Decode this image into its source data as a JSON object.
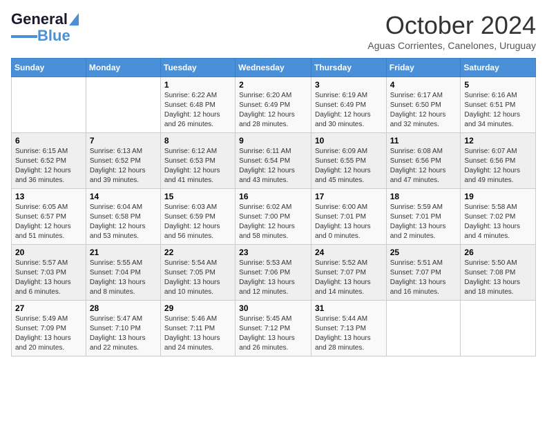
{
  "logo": {
    "line1": "General",
    "line2": "Blue"
  },
  "header": {
    "month": "October 2024",
    "location": "Aguas Corrientes, Canelones, Uruguay"
  },
  "days_of_week": [
    "Sunday",
    "Monday",
    "Tuesday",
    "Wednesday",
    "Thursday",
    "Friday",
    "Saturday"
  ],
  "weeks": [
    [
      {
        "day": "",
        "content": ""
      },
      {
        "day": "",
        "content": ""
      },
      {
        "day": "1",
        "content": "Sunrise: 6:22 AM\nSunset: 6:48 PM\nDaylight: 12 hours and 26 minutes."
      },
      {
        "day": "2",
        "content": "Sunrise: 6:20 AM\nSunset: 6:49 PM\nDaylight: 12 hours and 28 minutes."
      },
      {
        "day": "3",
        "content": "Sunrise: 6:19 AM\nSunset: 6:49 PM\nDaylight: 12 hours and 30 minutes."
      },
      {
        "day": "4",
        "content": "Sunrise: 6:17 AM\nSunset: 6:50 PM\nDaylight: 12 hours and 32 minutes."
      },
      {
        "day": "5",
        "content": "Sunrise: 6:16 AM\nSunset: 6:51 PM\nDaylight: 12 hours and 34 minutes."
      }
    ],
    [
      {
        "day": "6",
        "content": "Sunrise: 6:15 AM\nSunset: 6:52 PM\nDaylight: 12 hours and 36 minutes."
      },
      {
        "day": "7",
        "content": "Sunrise: 6:13 AM\nSunset: 6:52 PM\nDaylight: 12 hours and 39 minutes."
      },
      {
        "day": "8",
        "content": "Sunrise: 6:12 AM\nSunset: 6:53 PM\nDaylight: 12 hours and 41 minutes."
      },
      {
        "day": "9",
        "content": "Sunrise: 6:11 AM\nSunset: 6:54 PM\nDaylight: 12 hours and 43 minutes."
      },
      {
        "day": "10",
        "content": "Sunrise: 6:09 AM\nSunset: 6:55 PM\nDaylight: 12 hours and 45 minutes."
      },
      {
        "day": "11",
        "content": "Sunrise: 6:08 AM\nSunset: 6:56 PM\nDaylight: 12 hours and 47 minutes."
      },
      {
        "day": "12",
        "content": "Sunrise: 6:07 AM\nSunset: 6:56 PM\nDaylight: 12 hours and 49 minutes."
      }
    ],
    [
      {
        "day": "13",
        "content": "Sunrise: 6:05 AM\nSunset: 6:57 PM\nDaylight: 12 hours and 51 minutes."
      },
      {
        "day": "14",
        "content": "Sunrise: 6:04 AM\nSunset: 6:58 PM\nDaylight: 12 hours and 53 minutes."
      },
      {
        "day": "15",
        "content": "Sunrise: 6:03 AM\nSunset: 6:59 PM\nDaylight: 12 hours and 56 minutes."
      },
      {
        "day": "16",
        "content": "Sunrise: 6:02 AM\nSunset: 7:00 PM\nDaylight: 12 hours and 58 minutes."
      },
      {
        "day": "17",
        "content": "Sunrise: 6:00 AM\nSunset: 7:01 PM\nDaylight: 13 hours and 0 minutes."
      },
      {
        "day": "18",
        "content": "Sunrise: 5:59 AM\nSunset: 7:01 PM\nDaylight: 13 hours and 2 minutes."
      },
      {
        "day": "19",
        "content": "Sunrise: 5:58 AM\nSunset: 7:02 PM\nDaylight: 13 hours and 4 minutes."
      }
    ],
    [
      {
        "day": "20",
        "content": "Sunrise: 5:57 AM\nSunset: 7:03 PM\nDaylight: 13 hours and 6 minutes."
      },
      {
        "day": "21",
        "content": "Sunrise: 5:55 AM\nSunset: 7:04 PM\nDaylight: 13 hours and 8 minutes."
      },
      {
        "day": "22",
        "content": "Sunrise: 5:54 AM\nSunset: 7:05 PM\nDaylight: 13 hours and 10 minutes."
      },
      {
        "day": "23",
        "content": "Sunrise: 5:53 AM\nSunset: 7:06 PM\nDaylight: 13 hours and 12 minutes."
      },
      {
        "day": "24",
        "content": "Sunrise: 5:52 AM\nSunset: 7:07 PM\nDaylight: 13 hours and 14 minutes."
      },
      {
        "day": "25",
        "content": "Sunrise: 5:51 AM\nSunset: 7:07 PM\nDaylight: 13 hours and 16 minutes."
      },
      {
        "day": "26",
        "content": "Sunrise: 5:50 AM\nSunset: 7:08 PM\nDaylight: 13 hours and 18 minutes."
      }
    ],
    [
      {
        "day": "27",
        "content": "Sunrise: 5:49 AM\nSunset: 7:09 PM\nDaylight: 13 hours and 20 minutes."
      },
      {
        "day": "28",
        "content": "Sunrise: 5:47 AM\nSunset: 7:10 PM\nDaylight: 13 hours and 22 minutes."
      },
      {
        "day": "29",
        "content": "Sunrise: 5:46 AM\nSunset: 7:11 PM\nDaylight: 13 hours and 24 minutes."
      },
      {
        "day": "30",
        "content": "Sunrise: 5:45 AM\nSunset: 7:12 PM\nDaylight: 13 hours and 26 minutes."
      },
      {
        "day": "31",
        "content": "Sunrise: 5:44 AM\nSunset: 7:13 PM\nDaylight: 13 hours and 28 minutes."
      },
      {
        "day": "",
        "content": ""
      },
      {
        "day": "",
        "content": ""
      }
    ]
  ]
}
